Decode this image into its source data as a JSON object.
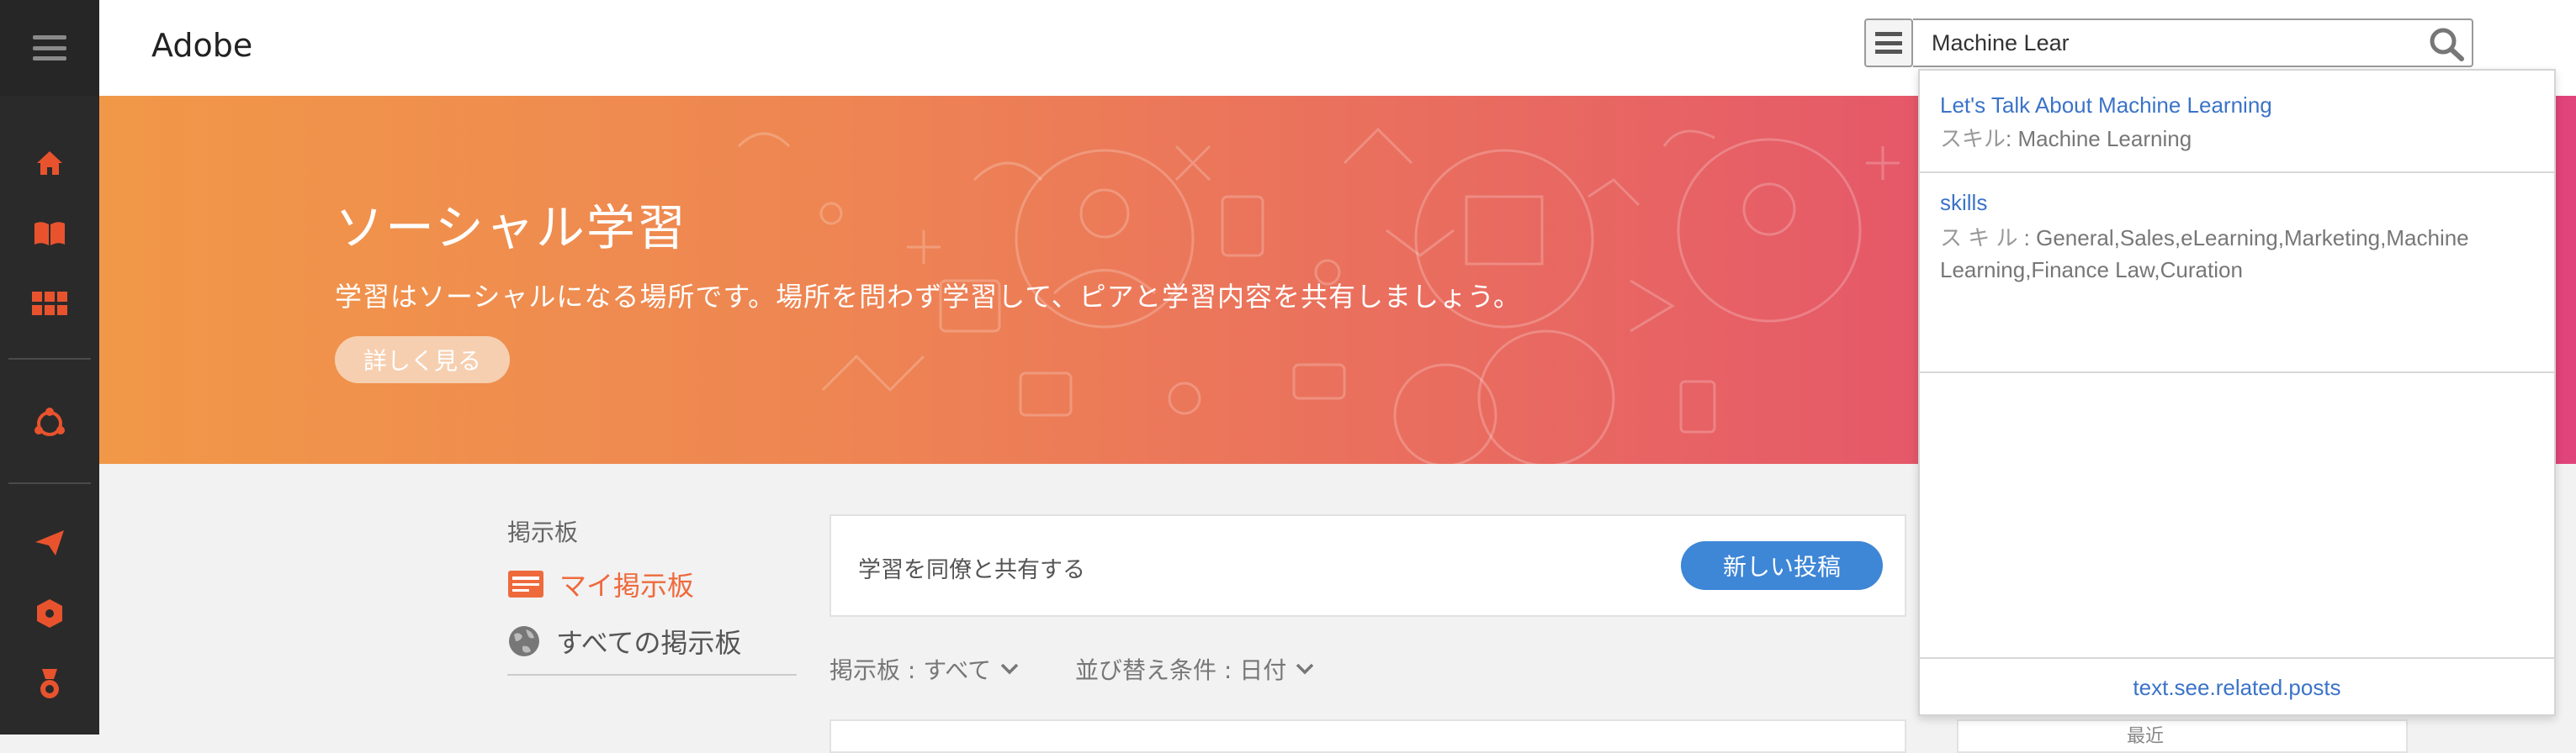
{
  "app": {
    "brand": "Adobe"
  },
  "search": {
    "value": "Machine Lear"
  },
  "hero": {
    "title": "ソーシャル学習",
    "subtitle": "学習はソーシャルになる場所です。場所を問わず学習して、ピアと学習内容を共有しましょう。",
    "button_label": "詳しく見る"
  },
  "boards": {
    "section_label": "掲示板",
    "my_board": "マイ掲示板",
    "all_boards": "すべての掲示板"
  },
  "post": {
    "placeholder": "学習を同僚と共有する",
    "new_post_label": "新しい投稿"
  },
  "filters": {
    "board": "掲示板 : すべて",
    "sort": "並び替え条件 : 日付"
  },
  "right_card_partial": "最近",
  "suggestions": {
    "items": [
      {
        "title": "Let's Talk About Machine Learning",
        "meta_label": "スキル",
        "meta_value": ": Machine Learning"
      },
      {
        "title": "skills",
        "meta_label": "ス キ ル",
        "meta_value": " :  General,Sales,eLearning,Marketing,Machine Learning,Finance Law,Curation"
      }
    ],
    "footer": "text.see.related.posts"
  },
  "icons": {
    "rail": [
      "menu-icon",
      "home-icon",
      "book-icon",
      "grid-icon",
      "social-icon",
      "send-icon",
      "badge-icon",
      "award-icon"
    ],
    "search": "search-icon",
    "my_board": "board-card-icon",
    "all_boards": "globe-icon"
  },
  "colors": {
    "rail_bg": "#2a2a2a",
    "rail_icon": "#e8532e",
    "hero_start": "#f19848",
    "hero_end": "#e0447a",
    "accent_blue": "#3e86d6",
    "link_blue": "#3b73c8",
    "active_board": "#ee6a3c"
  }
}
